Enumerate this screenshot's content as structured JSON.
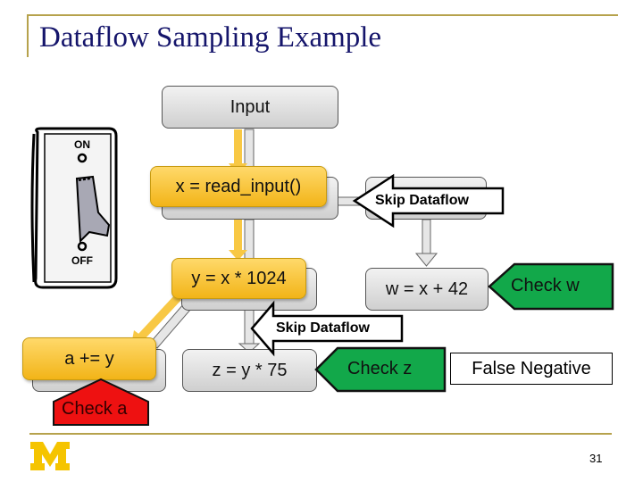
{
  "slide": {
    "title": "Dataflow Sampling Example",
    "page_number": "31",
    "logo": "university-m-logo"
  },
  "switch": {
    "on_label": "ON",
    "off_label": "OFF",
    "state": "OFF"
  },
  "nodes": {
    "input": "Input",
    "read_input": "x = read_input()",
    "y_assign": "y = x * 1024",
    "w_assign": "w = x + 42",
    "a_assign": "a += y",
    "z_assign": "z = y * 75"
  },
  "callouts": {
    "skip_dataflow_1": "Skip Dataflow",
    "skip_dataflow_2": "Skip Dataflow",
    "check_w": "Check w",
    "check_z": "Check z",
    "check_a": "Check a",
    "false_negative": "False Negative"
  },
  "colors": {
    "title": "#15156b",
    "rule": "#b6a24c",
    "highlight": "#f2b418",
    "check_green": "#12a84a",
    "check_red": "#ee1111",
    "logo": "#f5c400"
  }
}
